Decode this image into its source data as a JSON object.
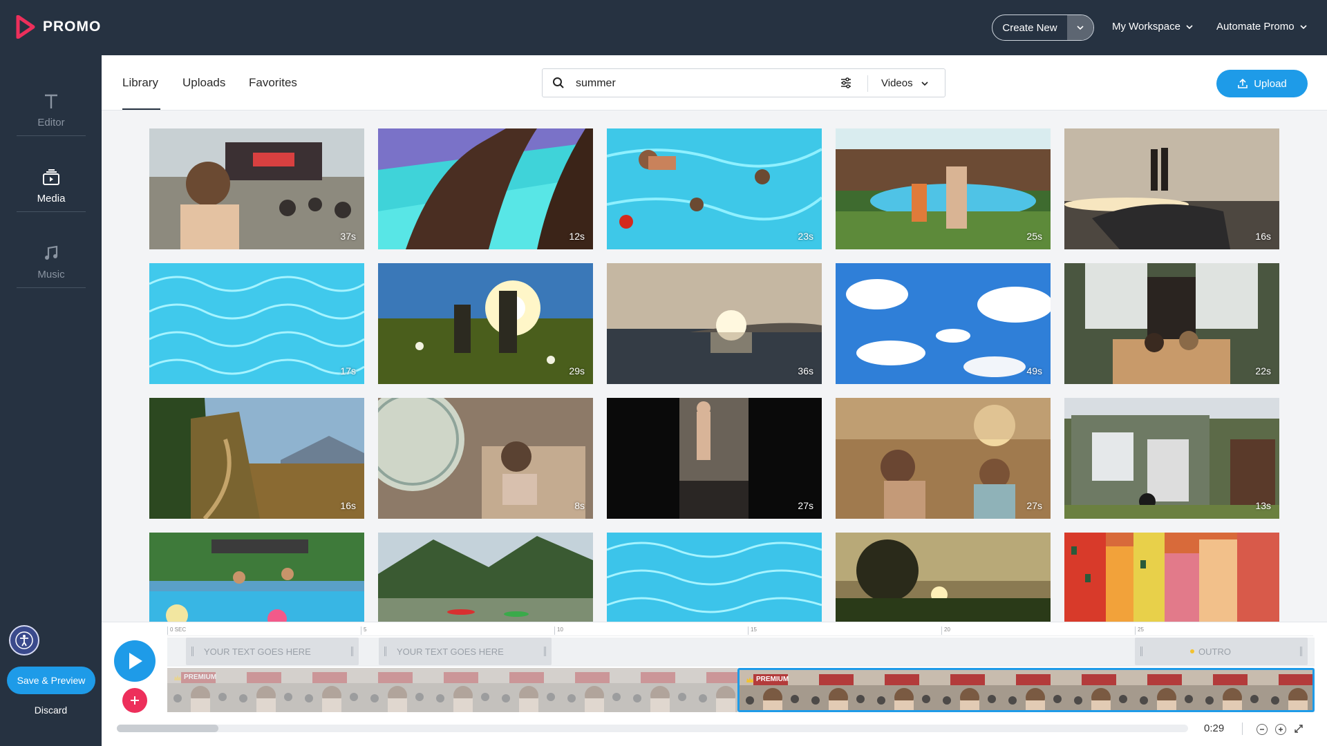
{
  "brand": {
    "name": "PROMO",
    "accent": "#ed2f5b",
    "primary": "#1e9be8",
    "dark": "#263241"
  },
  "topbar": {
    "create_new": "Create New",
    "workspace": "My Workspace",
    "automate": "Automate Promo"
  },
  "sidebar": {
    "items": [
      {
        "label": "Editor",
        "icon": "text-t-icon"
      },
      {
        "label": "Media",
        "icon": "media-stack-icon"
      },
      {
        "label": "Music",
        "icon": "music-note-icon"
      }
    ],
    "save_preview": "Save & Preview",
    "discard": "Discard"
  },
  "header": {
    "tabs": [
      "Library",
      "Uploads",
      "Favorites"
    ],
    "active_tab": "Library",
    "search_value": "summer",
    "media_type": "Videos",
    "upload": "Upload"
  },
  "grid": {
    "items": [
      {
        "duration": "37s",
        "scene": "festival-crowd"
      },
      {
        "duration": "12s",
        "scene": "paddle-board"
      },
      {
        "duration": "23s",
        "scene": "pool-swimmers"
      },
      {
        "duration": "25s",
        "scene": "backyard-pool"
      },
      {
        "duration": "16s",
        "scene": "boat-sunset"
      },
      {
        "duration": "17s",
        "scene": "pool-water"
      },
      {
        "duration": "29s",
        "scene": "meadow-sun"
      },
      {
        "duration": "36s",
        "scene": "sea-sunset"
      },
      {
        "duration": "49s",
        "scene": "blue-sky-clouds"
      },
      {
        "duration": "22s",
        "scene": "porch-couple"
      },
      {
        "duration": "16s",
        "scene": "forest-hill"
      },
      {
        "duration": "8s",
        "scene": "fan-woman"
      },
      {
        "duration": "27s",
        "scene": "concert-hand"
      },
      {
        "duration": "27s",
        "scene": "dancing-festival"
      },
      {
        "duration": "13s",
        "scene": "house-dog"
      },
      {
        "duration": "",
        "scene": "pool-party"
      },
      {
        "duration": "",
        "scene": "kayak-lake"
      },
      {
        "duration": "",
        "scene": "pool-water-2"
      },
      {
        "duration": "",
        "scene": "sunset-tree"
      },
      {
        "duration": "",
        "scene": "colorful-houses"
      }
    ]
  },
  "timeline": {
    "ruler": [
      "0 SEC",
      "5",
      "10",
      "15",
      "20",
      "25"
    ],
    "text_blocks": [
      "YOUR TEXT GOES HERE",
      "YOUR TEXT GOES HERE"
    ],
    "outro": "OUTRO",
    "premium": "PREMIUM",
    "time": "0:29"
  }
}
